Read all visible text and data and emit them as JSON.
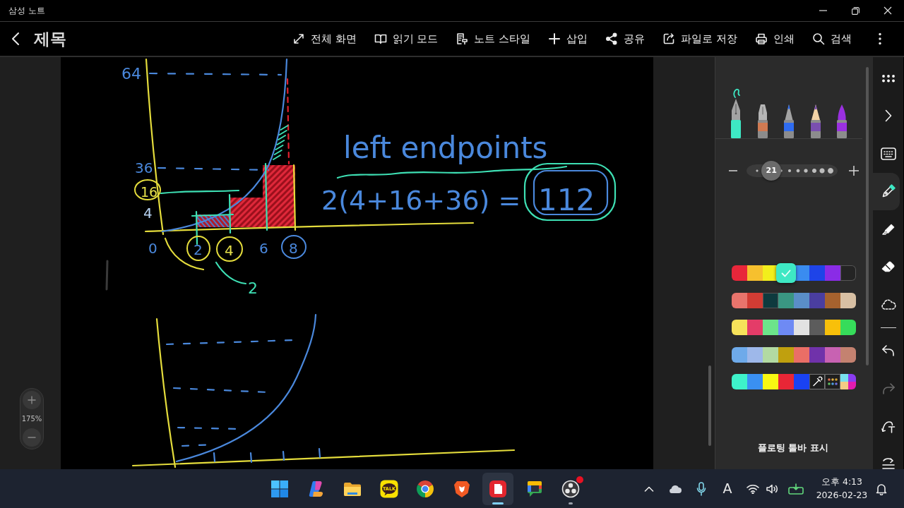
{
  "window": {
    "title": "삼성 노트"
  },
  "header": {
    "title": "제목",
    "actions": [
      {
        "kind": "fullscreen",
        "label": "전체 화면"
      },
      {
        "kind": "reading",
        "label": "읽기 모드"
      },
      {
        "kind": "style",
        "label": "노트 스타일"
      },
      {
        "kind": "insert",
        "label": "삽입"
      },
      {
        "kind": "share",
        "label": "공유"
      },
      {
        "kind": "export",
        "label": "파일로 저장"
      },
      {
        "kind": "print",
        "label": "인쇄"
      },
      {
        "kind": "search",
        "label": "검색"
      }
    ]
  },
  "canvas": {
    "zoom": "175%",
    "notes": [
      {
        "text": "64",
        "color": "#4a88dc"
      },
      {
        "text": "36",
        "color": "#4a88dc"
      },
      {
        "text": "16",
        "color": "#e6e04a"
      },
      {
        "text": "4",
        "color": "#b8d4f4"
      },
      {
        "text": "0",
        "color": "#4a88dc"
      },
      {
        "text": "2",
        "color": "#4a88dc"
      },
      {
        "text": "4",
        "color": "#e6e04a"
      },
      {
        "text": "6",
        "color": "#4a88dc"
      },
      {
        "text": "8",
        "color": "#4a88dc"
      },
      {
        "text": "2",
        "color": "#3ee0b4"
      },
      {
        "text": "left endpoints",
        "color": "#4a88dc"
      },
      {
        "text": "2(4+16+36) =",
        "color": "#4a88dc"
      },
      {
        "text": "112",
        "color": "#4a88dc"
      }
    ]
  },
  "pen_panel": {
    "pens": [
      {
        "kind": "fountain",
        "color": "#3ee8c4",
        "selected": true
      },
      {
        "kind": "calligraphy",
        "color": "#d07a52",
        "selected": false
      },
      {
        "kind": "ballpoint",
        "color": "#2f6cf0",
        "selected": false
      },
      {
        "kind": "pencil",
        "color": "#7a4fb0",
        "selected": false
      },
      {
        "kind": "brush",
        "color": "#9a30e0",
        "selected": false
      }
    ],
    "size": {
      "value": "21",
      "level": 0.21
    },
    "palettes": [
      {
        "swatches": [
          {
            "color": "#e8263a",
            "selected": false
          },
          {
            "color": "#f6c02e",
            "selected": false
          },
          {
            "color": "#f2ee1c",
            "selected": false
          },
          {
            "color": "#3ee8c4",
            "selected": true
          },
          {
            "color": "#3a8cf0",
            "selected": false
          },
          {
            "color": "#1e44e8",
            "selected": false
          },
          {
            "color": "#8a2ce6",
            "selected": false
          },
          {
            "color": "#242424",
            "selected": false
          }
        ]
      },
      {
        "swatches": [
          {
            "color": "#e8746c",
            "selected": false
          },
          {
            "color": "#d23c34",
            "selected": false
          },
          {
            "color": "#0e3a3e",
            "selected": false
          },
          {
            "color": "#3a9682",
            "selected": false
          },
          {
            "color": "#5a8ec8",
            "selected": false
          },
          {
            "color": "#4a3ea0",
            "selected": false
          },
          {
            "color": "#a6622e",
            "selected": false
          },
          {
            "color": "#d8c0a4",
            "selected": false
          }
        ]
      },
      {
        "swatches": [
          {
            "color": "#f6e25a",
            "selected": false
          },
          {
            "color": "#e43c68",
            "selected": false
          },
          {
            "color": "#6ce48a",
            "selected": false
          },
          {
            "color": "#6e8af4",
            "selected": false
          },
          {
            "color": "#e2e2e2",
            "selected": false
          },
          {
            "color": "#5c5c5c",
            "selected": false
          },
          {
            "color": "#f8c00a",
            "selected": false
          },
          {
            "color": "#36dc5a",
            "selected": false
          }
        ]
      },
      {
        "swatches": [
          {
            "color": "#6eaaea",
            "selected": false
          },
          {
            "color": "#9eb8ea",
            "selected": false
          },
          {
            "color": "#b2daa2",
            "selected": false
          },
          {
            "color": "#c0a00e",
            "selected": false
          },
          {
            "color": "#ea6e66",
            "selected": false
          },
          {
            "color": "#7032aa",
            "selected": false
          },
          {
            "color": "#c862b2",
            "selected": false
          },
          {
            "color": "#c48270",
            "selected": false
          }
        ]
      },
      {
        "swatches": [
          {
            "color": "#3ef2ca",
            "selected": false
          },
          {
            "color": "#3a90f2",
            "selected": false
          },
          {
            "color": "#f8f812",
            "selected": false
          },
          {
            "color": "#e82636",
            "selected": false
          },
          {
            "color": "#1a42f2",
            "selected": false
          }
        ],
        "tools": [
          {
            "kind": "eyedropper"
          },
          {
            "kind": "more_colors"
          },
          {
            "kind": "custom"
          }
        ]
      }
    ],
    "floating_toolbar": "플로팅 툴바 표시"
  },
  "rail": {
    "tools": [
      {
        "kind": "pen",
        "selected": true
      },
      {
        "kind": "highlighter",
        "selected": false
      },
      {
        "kind": "eraser",
        "selected": false
      },
      {
        "kind": "lasso",
        "selected": false
      }
    ],
    "history": [
      {
        "kind": "undo",
        "disabled": false
      },
      {
        "kind": "redo",
        "disabled": true
      }
    ]
  },
  "taskbar": {
    "apps": [
      {
        "kind": "tiles",
        "selected": false,
        "running": false,
        "badge": false
      },
      {
        "kind": "ribbon",
        "selected": false,
        "running": false,
        "badge": false
      },
      {
        "kind": "folder",
        "selected": false,
        "running": false,
        "badge": false
      },
      {
        "kind": "talk",
        "text": "TALK",
        "selected": false,
        "running": false,
        "badge": false
      },
      {
        "kind": "segments",
        "selected": false,
        "running": false,
        "badge": false
      },
      {
        "kind": "shield",
        "selected": false,
        "running": false,
        "badge": false
      },
      {
        "kind": "notepad",
        "selected": true,
        "running": true,
        "badge": false
      },
      {
        "kind": "chat",
        "selected": false,
        "running": false,
        "badge": false
      },
      {
        "kind": "disc",
        "selected": false,
        "running": true,
        "badge": true
      }
    ],
    "ime": "A",
    "time": "오후 4:13",
    "date": "2026-02-23"
  }
}
